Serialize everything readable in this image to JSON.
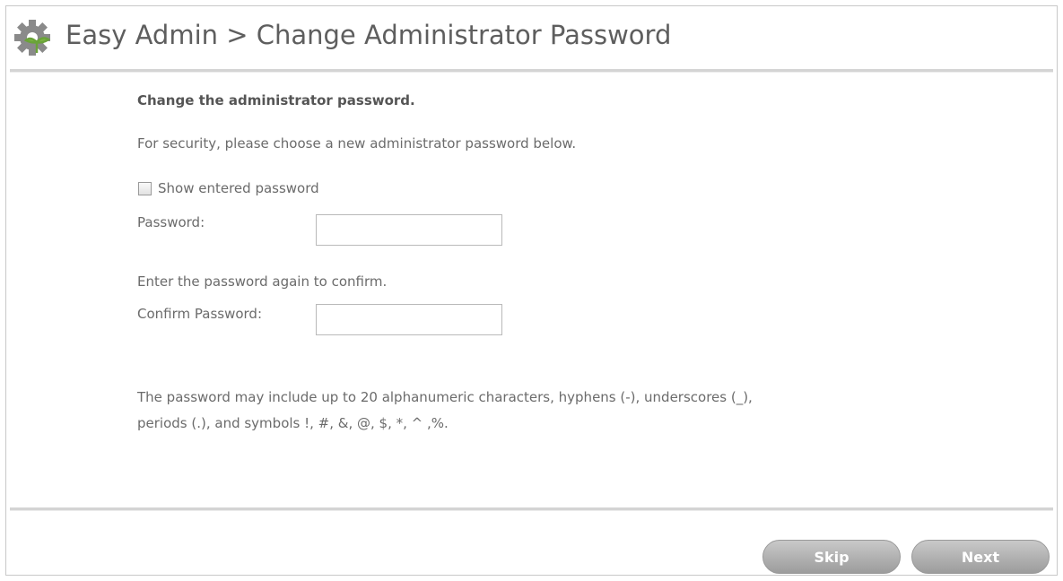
{
  "header": {
    "title": "Easy Admin > Change Administrator Password",
    "icon": "gear-plant-icon"
  },
  "content": {
    "heading": "Change the administrator password.",
    "intro": "For security, please choose a new administrator password below.",
    "show_password": {
      "label": "Show entered password",
      "checked": false
    },
    "password_label": "Password:",
    "password_value": "",
    "confirm_note": "Enter the password again to confirm.",
    "confirm_label": "Confirm Password:",
    "confirm_value": "",
    "rules_line1": "The password may include up to 20 alphanumeric characters, hyphens (-), underscores (_),",
    "rules_line2": "periods (.), and symbols !, #, &, @, $, *, ^ ,%."
  },
  "buttons": {
    "skip": "Skip",
    "next": "Next"
  },
  "colors": {
    "gear": "#8a8a8a",
    "leaf": "#7cb342",
    "button": "#ababab"
  }
}
